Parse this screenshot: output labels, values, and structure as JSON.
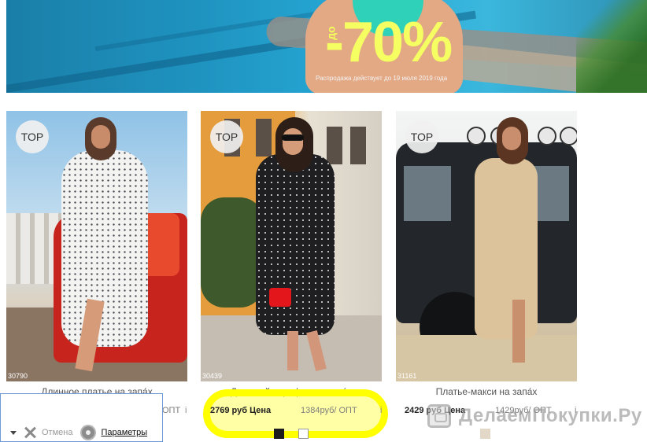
{
  "banner": {
    "promo_prefix": "до",
    "promo_discount": "-70%",
    "promo_note": "Распродажа действует до 19 июля 2019 года"
  },
  "products": [
    {
      "badge": "TOP",
      "article": "30790",
      "title": "Длинное платье на запа́х",
      "price": "",
      "opt_price": "ОПТ",
      "info": "i",
      "swatch_colors": []
    },
    {
      "badge": "TOP",
      "article": "30439",
      "title": "Длинный сарафан на запа́х",
      "price": "2769 руб Цена",
      "opt_price": "1384руб/ ОПТ",
      "info": "i",
      "swatch_colors": [
        "#1c1c1c",
        "#ffffff"
      ]
    },
    {
      "badge": "TOP",
      "article": "31161",
      "title": "Платье-макси на запа́х",
      "price": "2429 руб Цена",
      "opt_price": "1429руб/ ОПТ",
      "info": "i",
      "swatch_colors": [
        "#e3d7c7"
      ]
    }
  ],
  "popup": {
    "cancel_label": "Отмена",
    "params_label": "Параметры"
  },
  "watermark": {
    "text": "ДелаемПокупки.Ру"
  },
  "colors": {
    "highlight": "#ffff00",
    "promo_text": "#f6ff62",
    "popup_border": "#6d9ad4"
  }
}
